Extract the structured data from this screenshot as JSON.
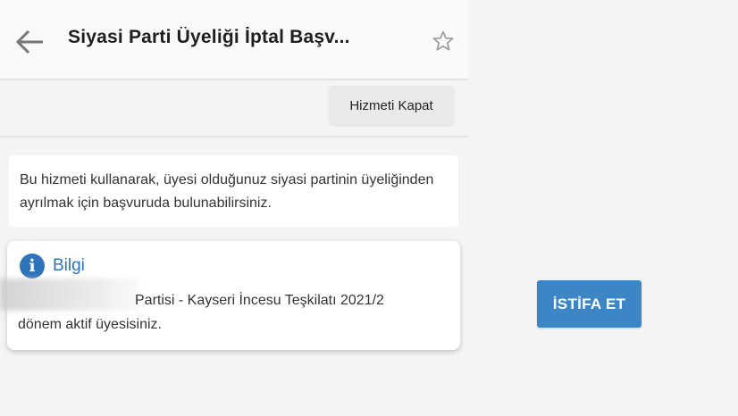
{
  "header": {
    "title": "Siyasi Parti Üyeliği İptal Başv...",
    "back_icon": "arrow-left-icon",
    "star_icon": "star-outline-icon"
  },
  "toolbar": {
    "close_service_label": "Hizmeti Kapat"
  },
  "description": {
    "text": "Bu hizmeti kullanarak, üyesi olduğunuz siyasi partinin üyeliğinden ayrılmak için başvuruda bulunabilirsiniz."
  },
  "info": {
    "icon": "info-icon",
    "icon_glyph": "i",
    "title": "Bilgi",
    "line1": "Partisi - Kayseri İncesu Teşkilatı 2021/2",
    "line2": "dönem aktif üyesisiniz."
  },
  "action": {
    "resign_label": "İSTİFA ET"
  },
  "colors": {
    "accent": "#2f73b9",
    "button": "#3d86c6",
    "background": "#f4f4f4"
  }
}
